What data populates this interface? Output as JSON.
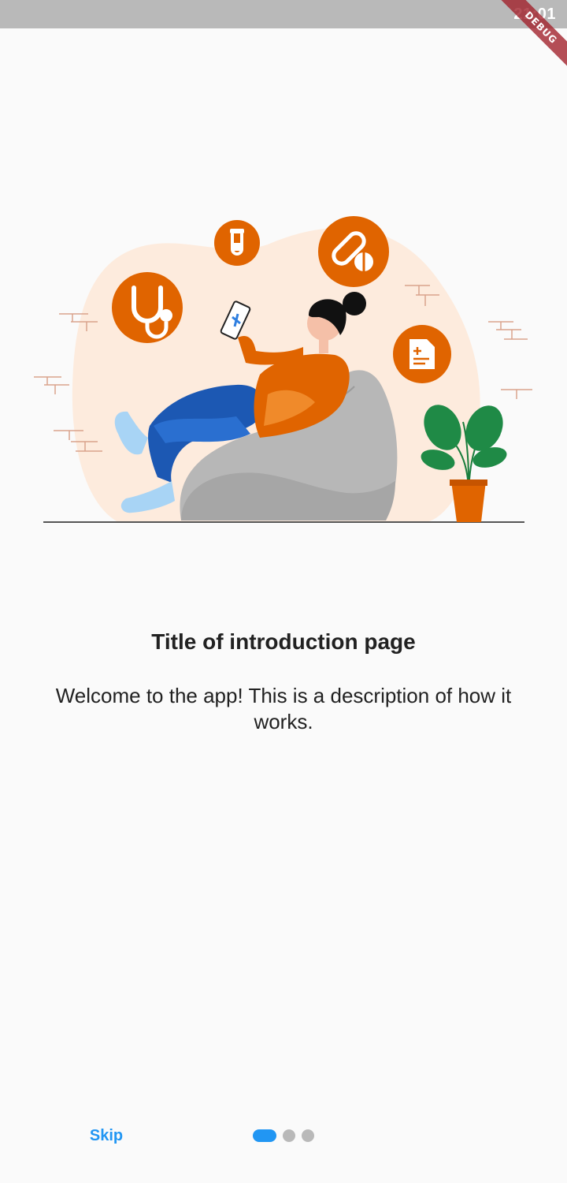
{
  "status_bar": {
    "time": "21:01",
    "debug_label": "DEBUG"
  },
  "intro": {
    "title": "Title of introduction page",
    "description": "Welcome to the app! This is a description of how it works.",
    "illustration_icon": "medical-illustration",
    "accent_color": "#e06400",
    "blob_color": "#fdebdd"
  },
  "footer": {
    "skip_label": "Skip",
    "page_count": 3,
    "current_page": 1,
    "active_color": "#2196f3",
    "inactive_color": "#b9b9b9"
  }
}
